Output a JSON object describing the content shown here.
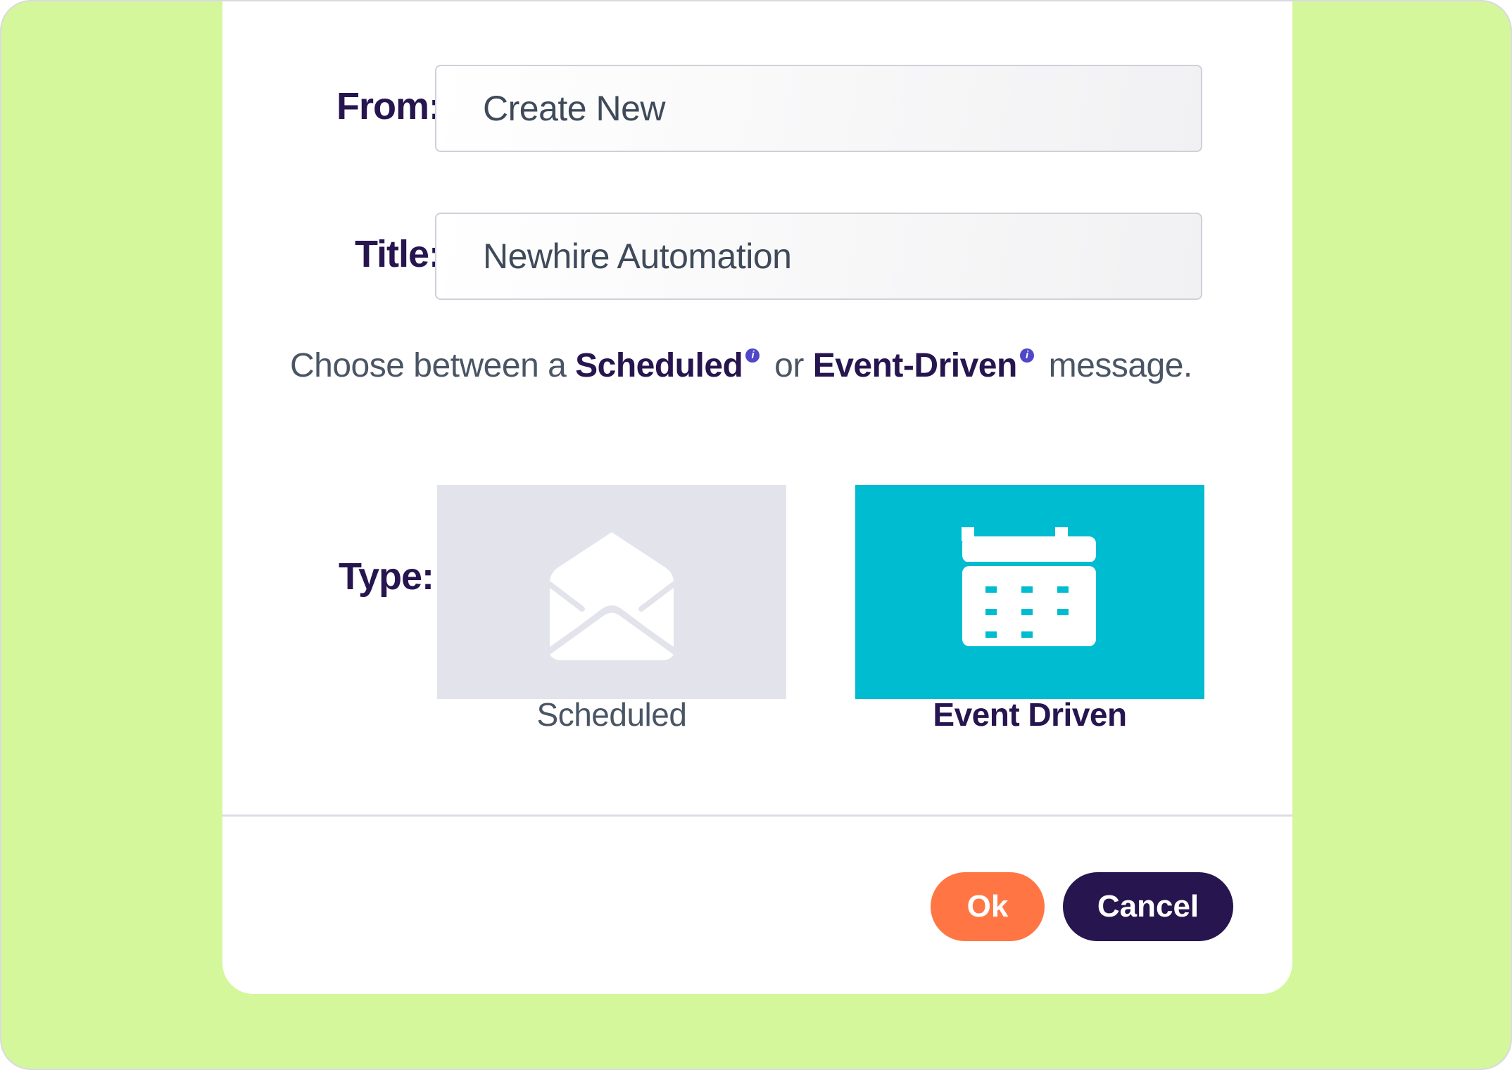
{
  "form": {
    "from_label": "From:",
    "from_value": "Create New",
    "title_label": "Title:",
    "title_value": "Newhire Automation",
    "type_label": "Type:"
  },
  "choice_text": {
    "prefix": "Choose between a ",
    "option1": "Scheduled",
    "middle": " or ",
    "option2": "Event-Driven",
    "suffix": " message.",
    "info_glyph": "i"
  },
  "types": [
    {
      "label": "Scheduled",
      "icon": "envelope-open-icon",
      "selected": false,
      "color": "#e3e3ec"
    },
    {
      "label": "Event Driven",
      "icon": "calendar-icon",
      "selected": true,
      "color": "#00bcd1"
    }
  ],
  "buttons": {
    "ok_label": "Ok",
    "cancel_label": "Cancel"
  },
  "colors": {
    "background": "#d4f79c",
    "brand_dark": "#27154f",
    "accent_orange": "#ff7644",
    "selected_cyan": "#00bcd1",
    "info_purple": "#5047c8"
  }
}
